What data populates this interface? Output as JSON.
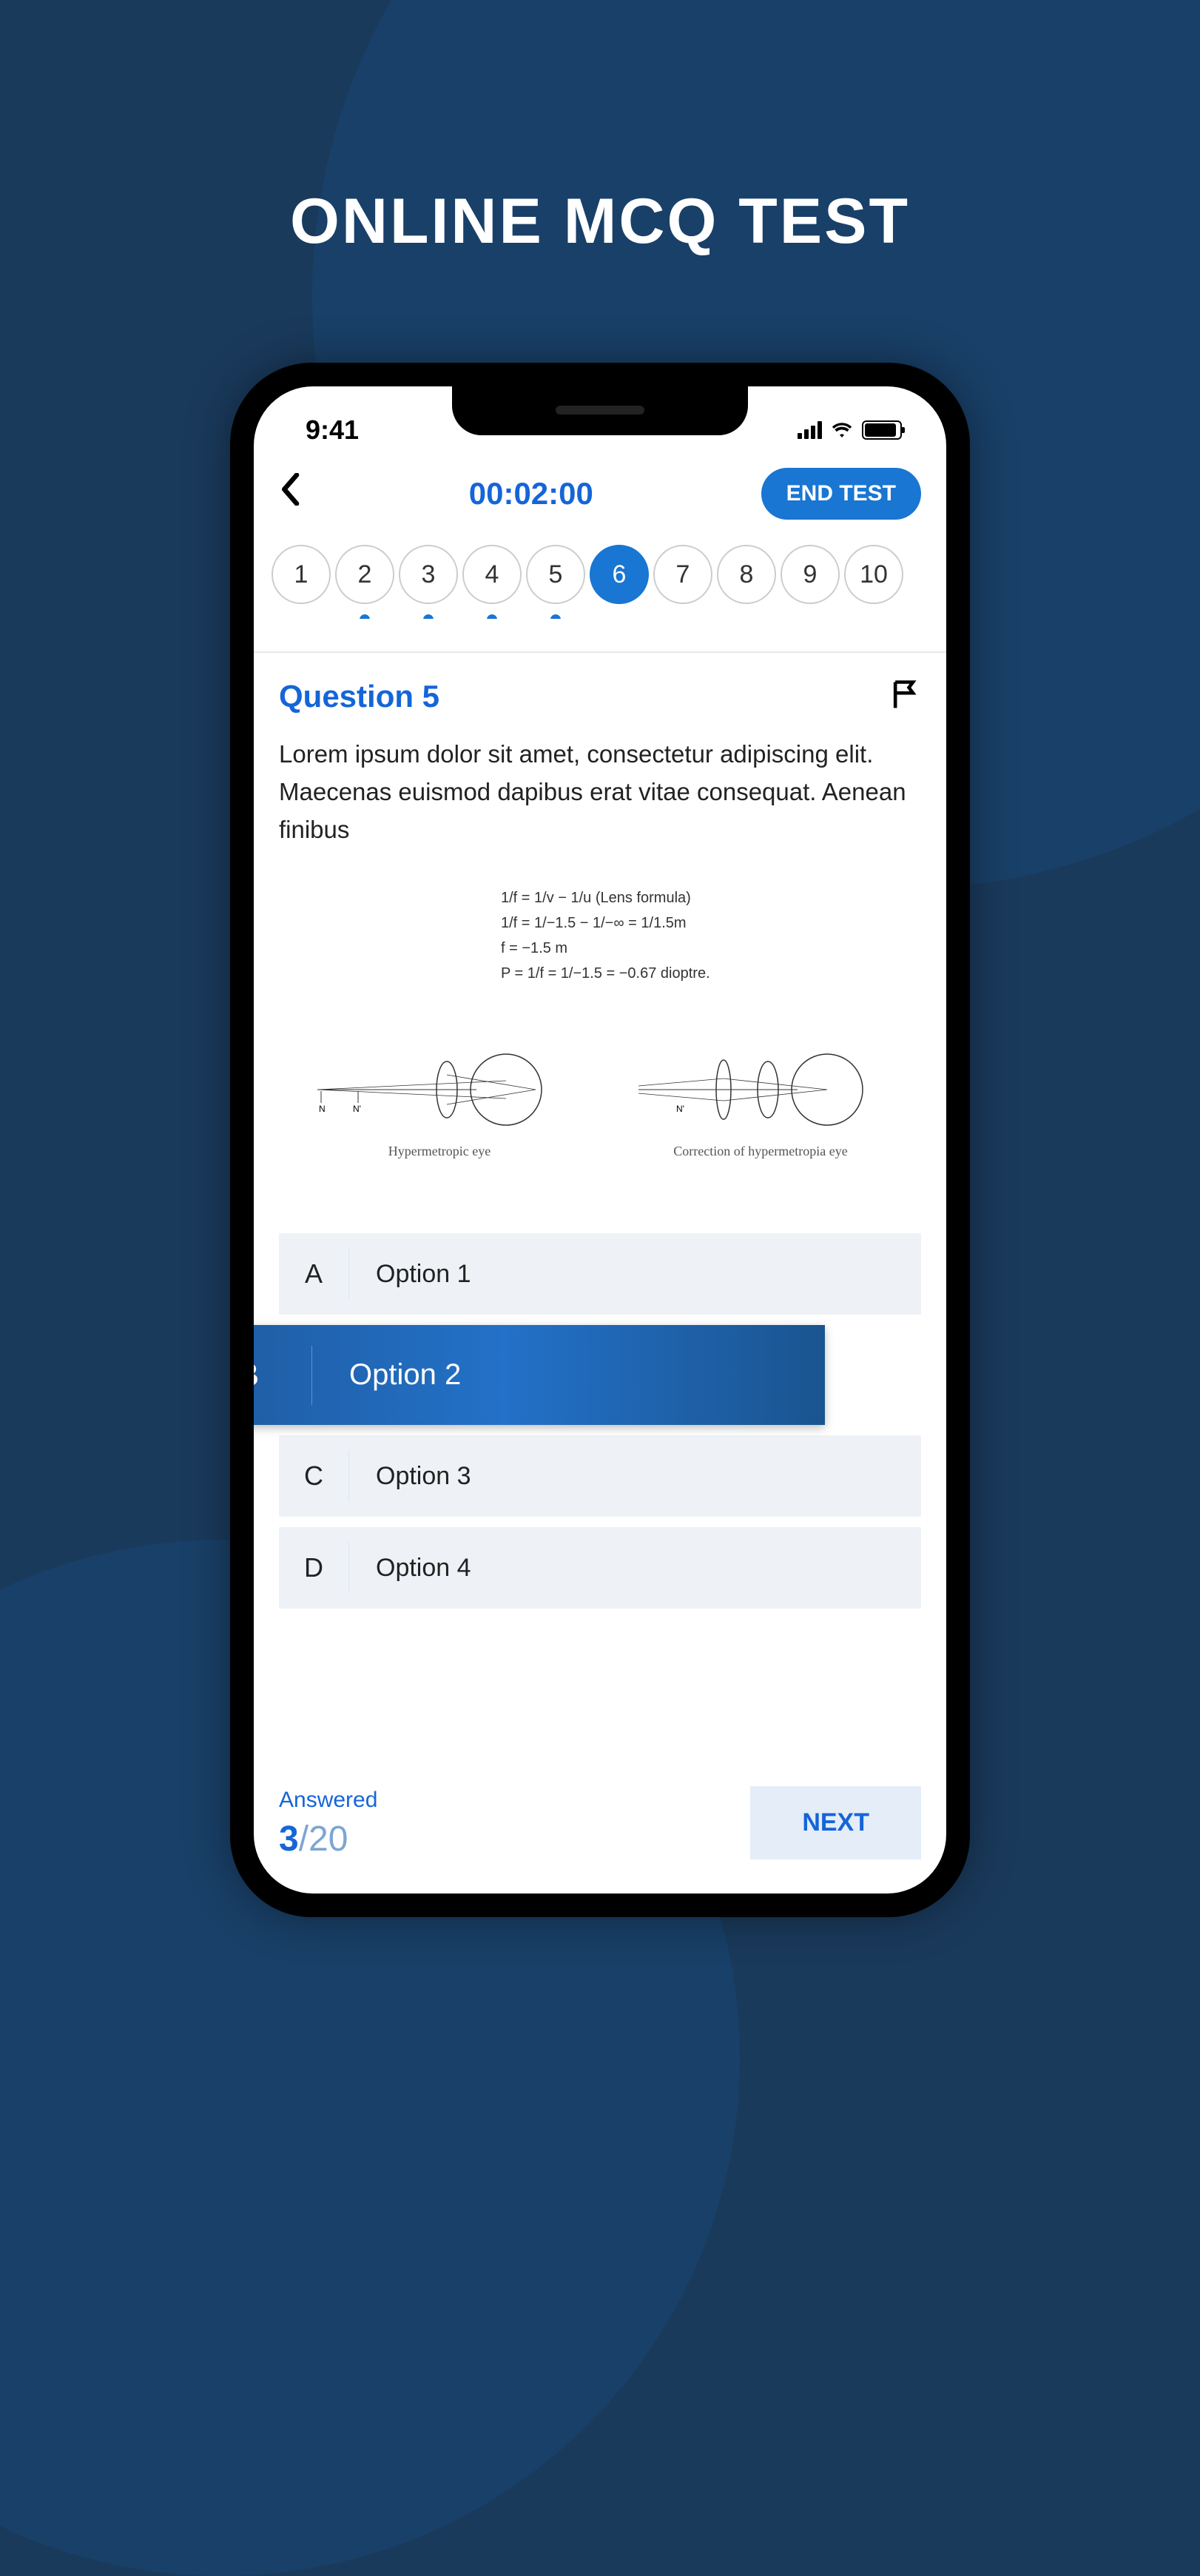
{
  "page_title": "ONLINE MCQ TEST",
  "status_bar": {
    "time": "9:41"
  },
  "header": {
    "timer": "00:02:00",
    "end_test_label": "END TEST"
  },
  "question_nav": [
    {
      "num": "1",
      "active": false,
      "answered": false
    },
    {
      "num": "2",
      "active": false,
      "answered": true
    },
    {
      "num": "3",
      "active": false,
      "answered": true
    },
    {
      "num": "4",
      "active": false,
      "answered": true
    },
    {
      "num": "5",
      "active": false,
      "answered": true
    },
    {
      "num": "6",
      "active": true,
      "answered": false
    },
    {
      "num": "7",
      "active": false,
      "answered": false
    },
    {
      "num": "8",
      "active": false,
      "answered": false
    },
    {
      "num": "9",
      "active": false,
      "answered": false
    },
    {
      "num": "10",
      "active": false,
      "answered": false
    }
  ],
  "question": {
    "title": "Question 5",
    "text": "Lorem ipsum dolor sit amet, consectetur adipiscing elit. Maecenas euismod dapibus erat vitae consequat. Aenean finibus",
    "diagram": {
      "formula_lines": [
        "1/f = 1/v − 1/u  (Lens formula)",
        "1/f = 1/−1.5 − 1/−∞ = 1/1.5m",
        "f = −1.5 m",
        "P = 1/f = 1/−1.5 = −0.67 dioptre."
      ],
      "left_label": "Hypermetropic eye",
      "right_label": "Correction of hypermetropia eye"
    }
  },
  "options": [
    {
      "letter": "A",
      "text": "Option 1",
      "selected": false
    },
    {
      "letter": "B",
      "text": "Option 2",
      "selected": true
    },
    {
      "letter": "C",
      "text": "Option 3",
      "selected": false
    },
    {
      "letter": "D",
      "text": "Option 4",
      "selected": false
    }
  ],
  "footer": {
    "answered_label": "Answered",
    "answered_count": "3",
    "total_count": "20",
    "next_label": "NEXT"
  }
}
